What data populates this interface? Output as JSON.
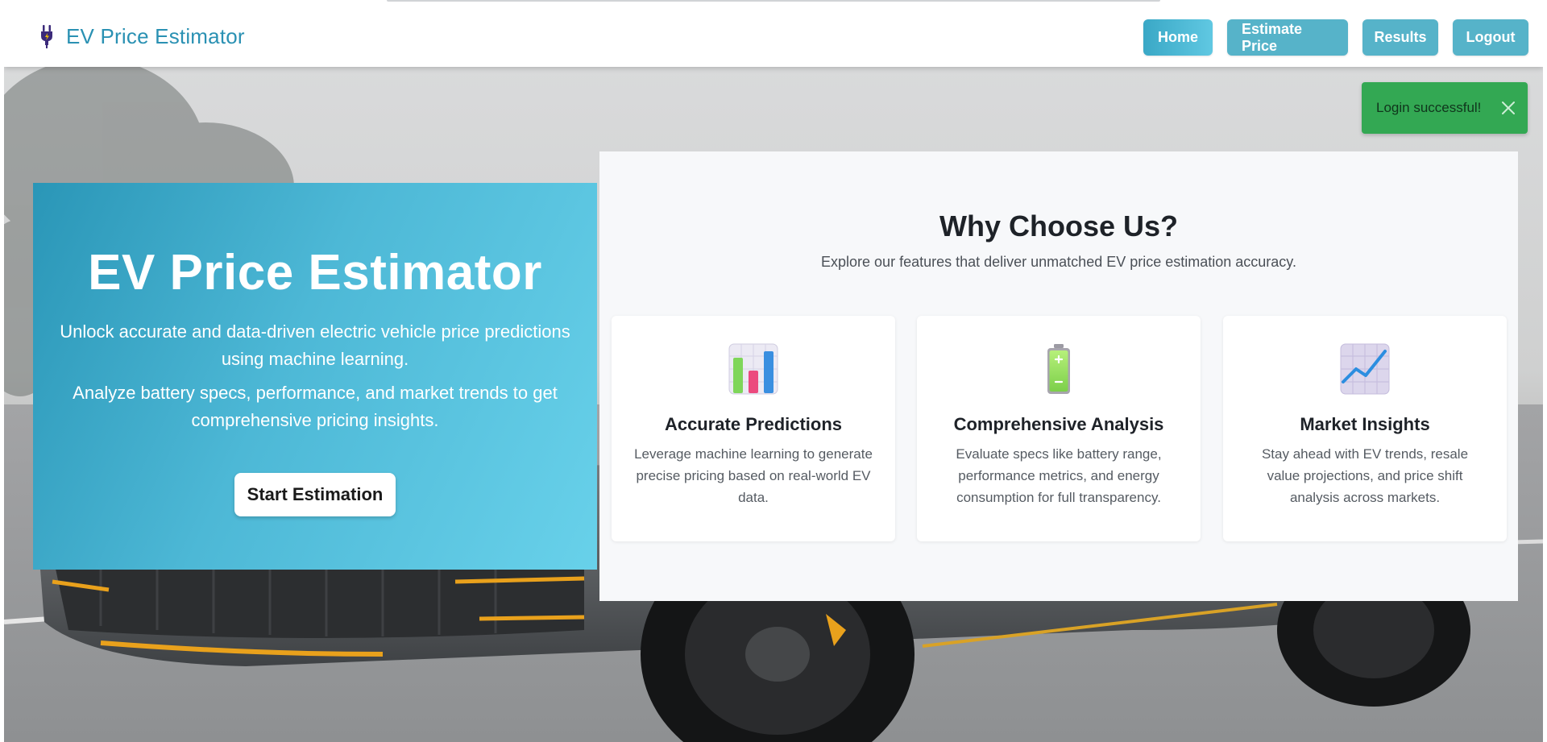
{
  "navbar": {
    "brand": "EV Price Estimator",
    "brand_icon": "ev-plug-icon",
    "buttons": {
      "home": "Home",
      "estimate": "Estimate Price",
      "results": "Results",
      "logout": "Logout"
    },
    "active": "Home"
  },
  "toast": {
    "message": "Login successful!",
    "close_icon": "close-icon",
    "color": "#33a853"
  },
  "hero": {
    "title": "EV Price Estimator",
    "paragraph1": "Unlock accurate and data-driven electric vehicle price predictions using machine learning.",
    "paragraph2": "Analyze battery specs, performance, and market trends to get comprehensive pricing insights.",
    "cta": "Start Estimation"
  },
  "features": {
    "title": "Why Choose Us?",
    "subtitle": "Explore our features that deliver unmatched EV price estimation accuracy.",
    "cards": [
      {
        "icon": "bar-chart-icon",
        "title": "Accurate Predictions",
        "description": "Leverage machine learning to generate precise pricing based on real-world EV data."
      },
      {
        "icon": "battery-icon",
        "title": "Comprehensive Analysis",
        "description": "Evaluate specs like battery range, performance metrics, and energy consumption for full transparency."
      },
      {
        "icon": "trend-chart-icon",
        "title": "Market Insights",
        "description": "Stay ahead with EV trends, resale value projections, and price shift analysis across markets."
      }
    ]
  },
  "colors": {
    "accent": "#2a91b3",
    "nav_button": "#56b3c9",
    "hero_gradient_start": "#2a96b7",
    "hero_gradient_end": "#68d1ea"
  }
}
